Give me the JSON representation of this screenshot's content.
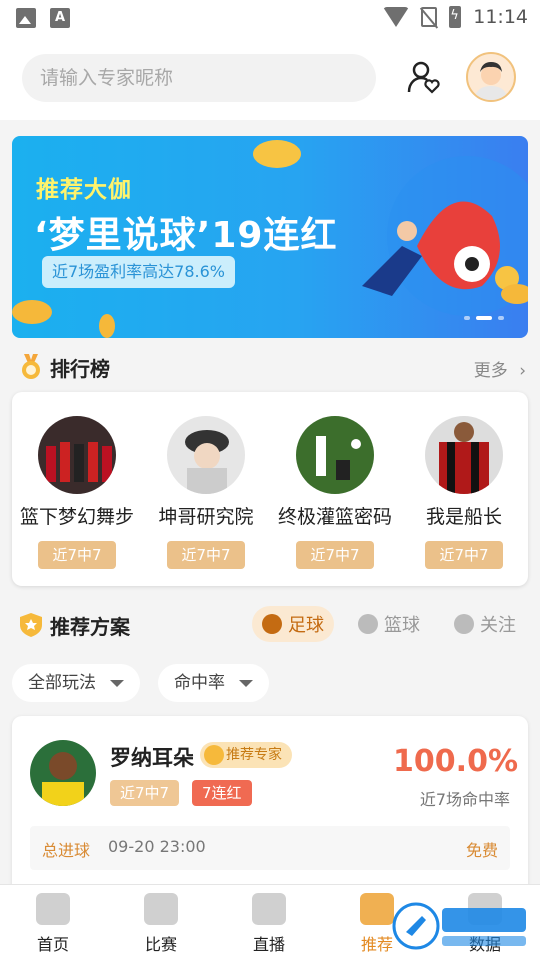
{
  "status_bar": {
    "time": "11:14"
  },
  "header": {
    "search_placeholder": "请输入专家昵称"
  },
  "banner": {
    "subtitle": "推荐大伽",
    "title": "‘梦里说球’19连红",
    "pill": "近7场盈利率高达78.6%"
  },
  "ranking": {
    "title": "排行榜",
    "more": "更多",
    "experts": [
      {
        "name": "篮下梦幻舞步",
        "tag": "近7中7"
      },
      {
        "name": "坤哥研究院",
        "tag": "近7中7"
      },
      {
        "name": "终极灌篮密码",
        "tag": "近7中7"
      },
      {
        "name": "我是船长",
        "tag": "近7中7"
      }
    ]
  },
  "recommend": {
    "title": "推荐方案",
    "tabs": [
      "足球",
      "篮球",
      "关注"
    ],
    "filters": [
      "全部玩法",
      "命中率"
    ]
  },
  "plan": {
    "name": "罗纳耳朵",
    "badge": "推荐专家",
    "pill1": "近7中7",
    "pill2": "7连红",
    "rate": "100.0%",
    "rate_label": "近7场命中率",
    "row": {
      "category": "总进球",
      "datetime": "09-20 23:00",
      "price": "免费"
    }
  },
  "nav": [
    "首页",
    "比赛",
    "直播",
    "推荐",
    "数据"
  ],
  "colors": {
    "accent": "#e38a22",
    "banner": "#1bb0ef",
    "rate": "#ef6a4d"
  }
}
